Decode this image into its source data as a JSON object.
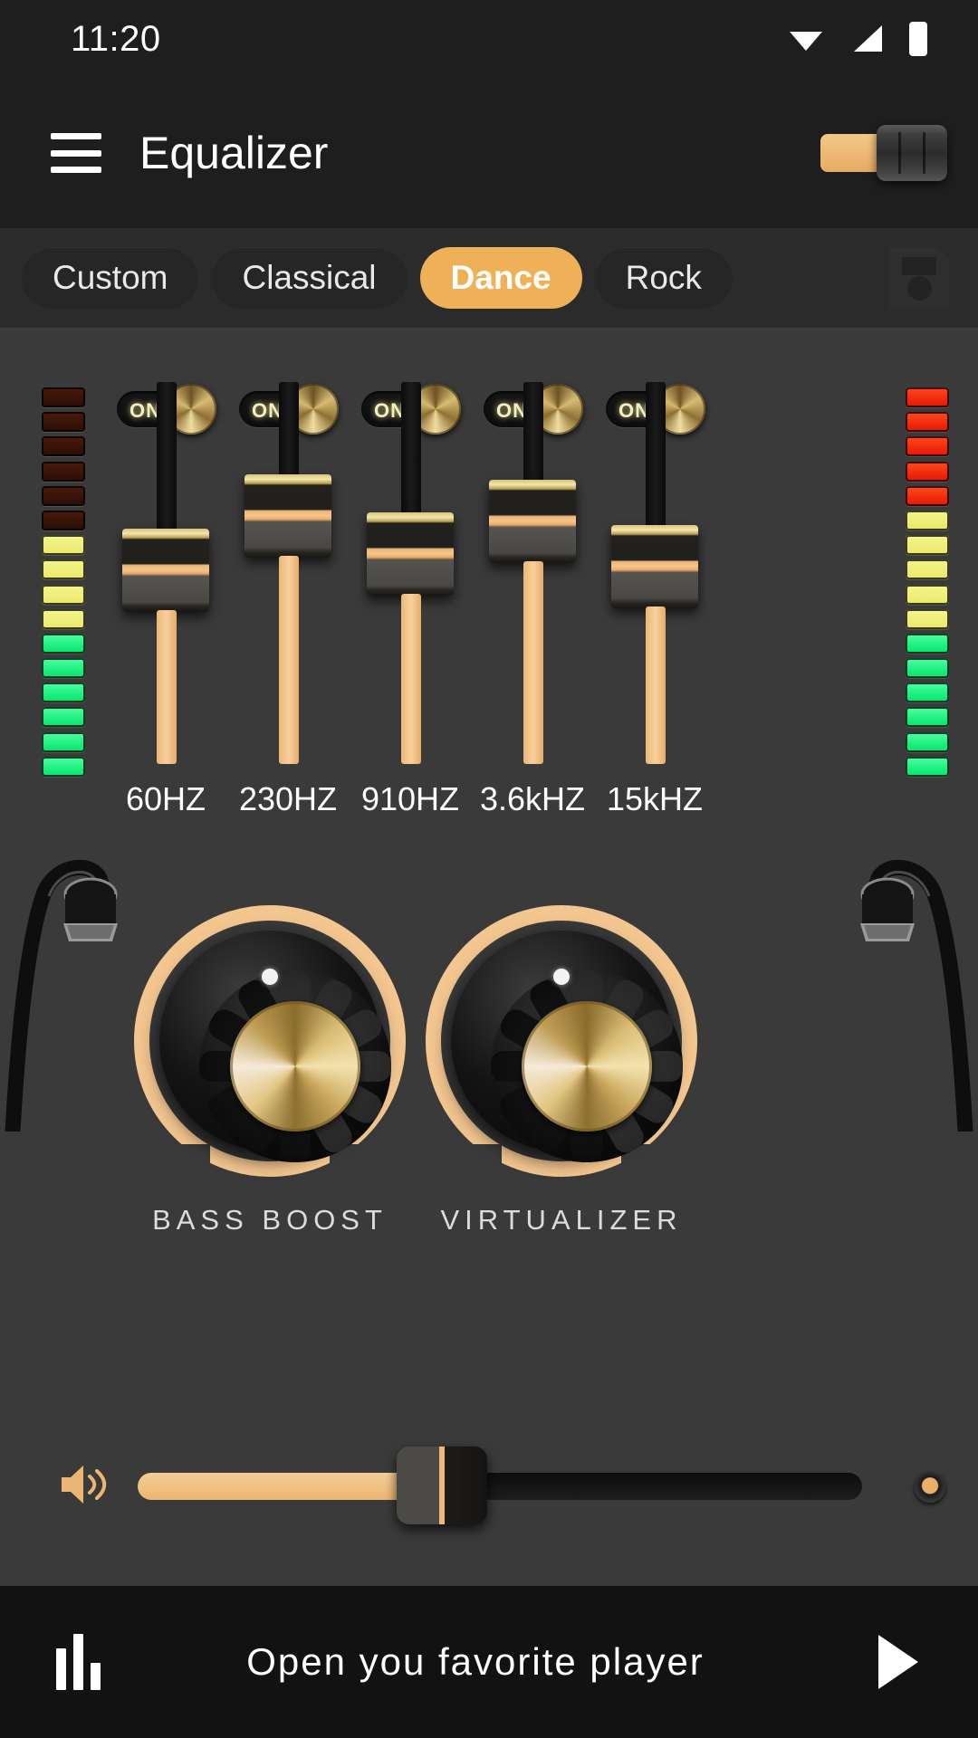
{
  "status_bar": {
    "time": "11:20",
    "icons": [
      "wifi-icon",
      "signal-icon",
      "battery-icon"
    ]
  },
  "app_bar": {
    "menu_icon": "hamburger-menu-icon",
    "title": "Equalizer",
    "power_switch": {
      "state": "on",
      "accent": "#eab672"
    }
  },
  "presets": {
    "tabs": [
      {
        "label": "Custom",
        "active": false
      },
      {
        "label": "Classical",
        "active": false
      },
      {
        "label": "Dance",
        "active": true
      },
      {
        "label": "Rock",
        "active": false
      }
    ],
    "save_icon": "floppy-disk-save-icon",
    "active_color": "#eeb158"
  },
  "equalizer": {
    "band_toggle_label": "ON",
    "bands": [
      {
        "label": "60HZ",
        "toggle": "ON",
        "level": 0.42
      },
      {
        "label": "230HZ",
        "toggle": "ON",
        "level": 0.66
      },
      {
        "label": "910HZ",
        "toggle": "ON",
        "level": 0.47
      },
      {
        "label": "3.6kHZ",
        "toggle": "ON",
        "level": 0.64
      },
      {
        "label": "15kHZ",
        "toggle": "ON",
        "level": 0.38
      }
    ],
    "vu_left": {
      "segments": 16,
      "lit": 10,
      "colors": [
        "green",
        "green",
        "green",
        "green",
        "green",
        "green",
        "yellow",
        "yellow",
        "yellow",
        "yellow",
        "off",
        "off",
        "off",
        "off",
        "off",
        "off"
      ]
    },
    "vu_right": {
      "segments": 16,
      "lit": 16,
      "colors": [
        "green",
        "green",
        "green",
        "green",
        "green",
        "green",
        "yellow",
        "yellow",
        "yellow",
        "yellow",
        "yellow",
        "red",
        "red",
        "red",
        "red",
        "red"
      ]
    }
  },
  "knobs": [
    {
      "label": "BASS BOOST",
      "value": 0.5
    },
    {
      "label": "VIRTUALIZER",
      "value": 0.5
    }
  ],
  "volume": {
    "speaker_icon": "volume-speaker-icon",
    "level": 0.42
  },
  "bottom_bar": {
    "icon": "equalizer-bars-icon",
    "text": "Open you favorite player",
    "play_icon": "play-triangle-icon"
  },
  "colors": {
    "accent": "#eab672",
    "panel_bg": "#3a3a3a",
    "bar_bg": "#1e1e1e",
    "vu_red": "#e41505",
    "vu_yellow": "#eaea74",
    "vu_green": "#00e46a"
  }
}
